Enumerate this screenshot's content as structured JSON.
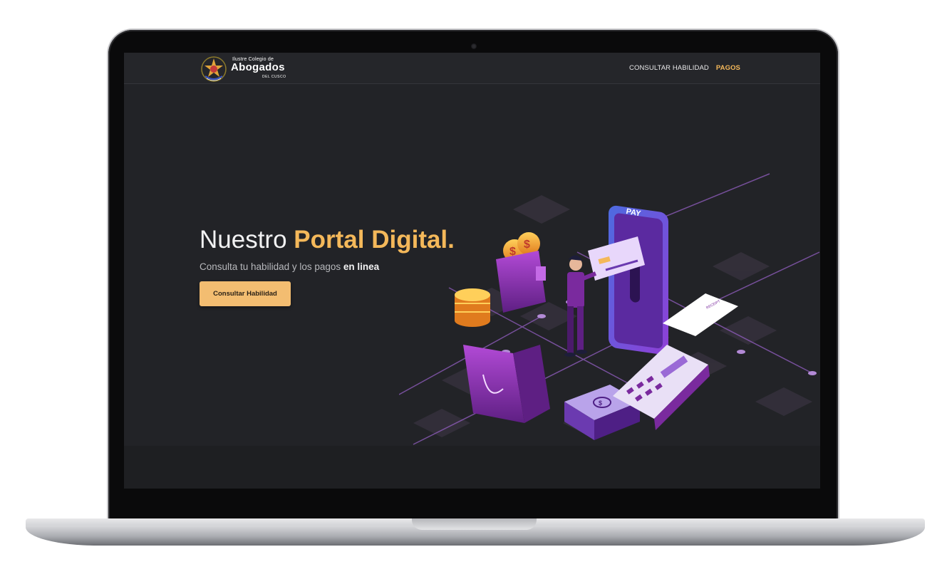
{
  "brand": {
    "line1": "Ilustre Colegio de",
    "name": "Abogados",
    "line2": "DEL CUSCO"
  },
  "nav": {
    "items": [
      {
        "label": "CONSULTAR HABILIDAD",
        "active": false
      },
      {
        "label": "PAGOS",
        "active": true
      }
    ]
  },
  "hero": {
    "title_plain": "Nuestro",
    "title_highlight": "Portal Digital.",
    "subtitle_plain": "Consulta tu habilidad y los pagos",
    "subtitle_bold": "en linea",
    "cta_label": "Consultar Habilidad"
  },
  "illustration": {
    "pay_label": "PAY",
    "receipt_label": "RECEIPT"
  },
  "colors": {
    "accent": "#f4b85a",
    "background": "#222327",
    "purple": "#7a2a9e"
  }
}
